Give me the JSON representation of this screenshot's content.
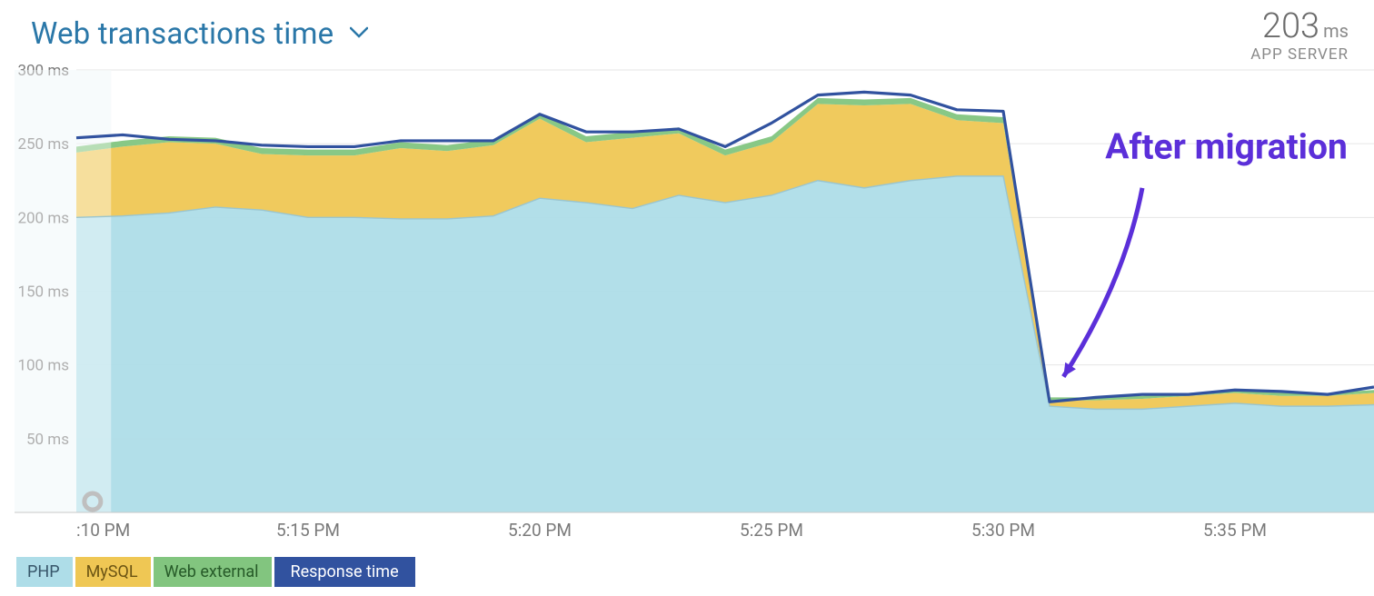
{
  "header": {
    "title": "Web transactions time"
  },
  "metric": {
    "value": "203",
    "unit": "ms",
    "sub": "APP SERVER"
  },
  "legend": {
    "php": "PHP",
    "mysql": "MySQL",
    "web": "Web external",
    "resp": "Response time"
  },
  "annotation": {
    "text": "After migration"
  },
  "chart_data": {
    "type": "area",
    "xlabel": "",
    "ylabel": "",
    "y_unit": "ms",
    "ylim": [
      0,
      300
    ],
    "y_ticks": [
      50,
      100,
      150,
      200,
      250,
      300
    ],
    "x_ticks_index": [
      0,
      5,
      10,
      15,
      20,
      25
    ],
    "x_ticks_label": [
      ":10 PM",
      "5:15 PM",
      "5:20 PM",
      "5:25 PM",
      "5:30 PM",
      "5:35 PM"
    ],
    "x": [
      0,
      1,
      2,
      3,
      4,
      5,
      6,
      7,
      8,
      9,
      10,
      11,
      12,
      13,
      14,
      15,
      16,
      17,
      18,
      19,
      20,
      21,
      22,
      23,
      24,
      25,
      26,
      27,
      28
    ],
    "series": [
      {
        "name": "PHP",
        "color": "#aedde8",
        "values": [
          200,
          201,
          203,
          207,
          205,
          200,
          200,
          199,
          199,
          201,
          213,
          210,
          206,
          215,
          210,
          215,
          225,
          220,
          225,
          228,
          228,
          72,
          70,
          70,
          72,
          74,
          72,
          72,
          73
        ]
      },
      {
        "name": "MySQL",
        "color": "#efc754",
        "values": [
          44,
          47,
          48,
          43,
          38,
          42,
          42,
          48,
          46,
          48,
          54,
          41,
          48,
          42,
          32,
          36,
          52,
          56,
          52,
          38,
          36,
          4,
          6,
          7,
          7,
          7,
          7,
          7,
          8
        ]
      },
      {
        "name": "Web external",
        "color": "#82c57f",
        "values": [
          4,
          4,
          4,
          4,
          4,
          4,
          4,
          4,
          4,
          4,
          4,
          4,
          4,
          4,
          4,
          4,
          4,
          4,
          4,
          4,
          4,
          2,
          2,
          2,
          2,
          2,
          2,
          2,
          2
        ]
      }
    ],
    "response_time": [
      254,
      256,
      253,
      252,
      249,
      248,
      248,
      252,
      252,
      252,
      270,
      258,
      258,
      260,
      248,
      264,
      283,
      285,
      283,
      273,
      272,
      75,
      78,
      80,
      80,
      83,
      82,
      80,
      85
    ],
    "annotations": [
      {
        "text": "After migration",
        "x_index": 22,
        "arrow_to_index": 21
      }
    ]
  }
}
